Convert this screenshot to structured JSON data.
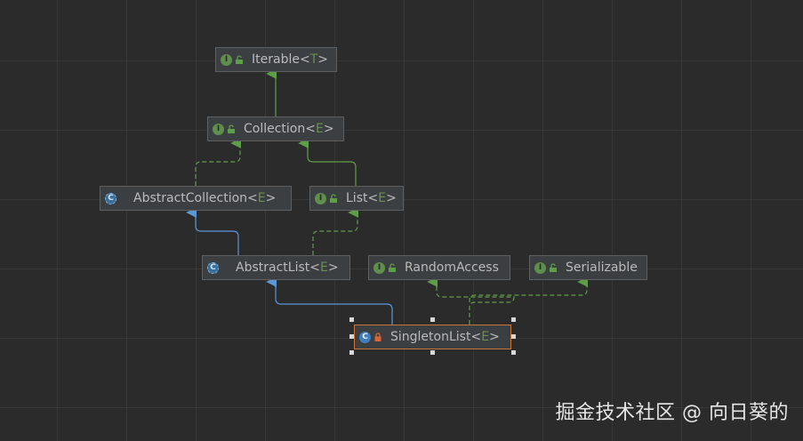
{
  "colors": {
    "background": "#2b2b2b",
    "node_fill": "#3c3f41",
    "node_border": "#5d5f61",
    "selected_border": "#c7763c",
    "interface_edge": "#5f9e48",
    "extends_edge": "#5c97d6",
    "type_param": "#6b8f52"
  },
  "nodes": {
    "iterable": {
      "name": "Iterable",
      "param": "T",
      "kind": "interface"
    },
    "collection": {
      "name": "Collection",
      "param": "E",
      "kind": "interface"
    },
    "abstract_collection": {
      "name": "AbstractCollection",
      "param": "E",
      "kind": "abstract-class"
    },
    "list": {
      "name": "List",
      "param": "E",
      "kind": "interface"
    },
    "abstract_list": {
      "name": "AbstractList",
      "param": "E",
      "kind": "abstract-class"
    },
    "random_access": {
      "name": "RandomAccess",
      "param": "",
      "kind": "interface"
    },
    "serializable": {
      "name": "Serializable",
      "param": "",
      "kind": "interface"
    },
    "singleton_list": {
      "name": "SingletonList",
      "param": "E",
      "kind": "class",
      "selected": true
    }
  },
  "edges": [
    {
      "from": "collection",
      "to": "iterable",
      "type": "extends-interface"
    },
    {
      "from": "abstract_collection",
      "to": "collection",
      "type": "implements"
    },
    {
      "from": "list",
      "to": "collection",
      "type": "extends-interface"
    },
    {
      "from": "abstract_list",
      "to": "abstract_collection",
      "type": "extends"
    },
    {
      "from": "abstract_list",
      "to": "list",
      "type": "implements"
    },
    {
      "from": "singleton_list",
      "to": "abstract_list",
      "type": "extends"
    },
    {
      "from": "singleton_list",
      "to": "random_access",
      "type": "implements"
    },
    {
      "from": "singleton_list",
      "to": "serializable",
      "type": "implements"
    }
  ],
  "watermark": "掘金技术社区 @ 向日葵的"
}
